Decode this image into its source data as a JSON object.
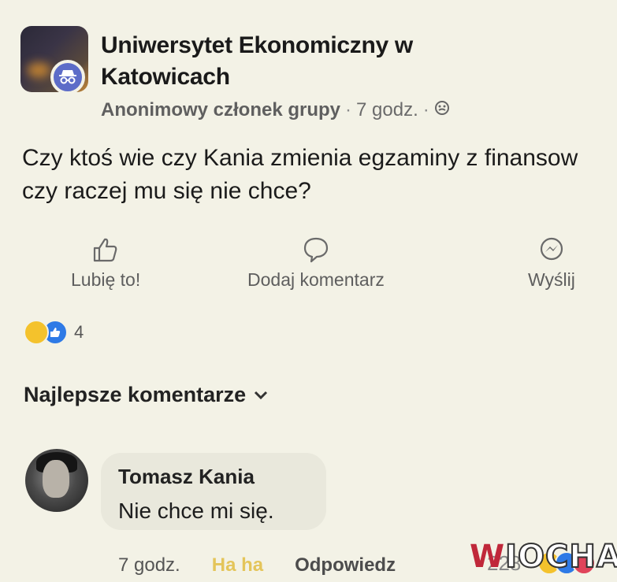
{
  "post": {
    "group_name": "Uniwersytet Ekonomiczny w Katowicach",
    "author": "Anonimowy członek grupy",
    "separator1": "·",
    "time": "7 godz.",
    "separator2": "·",
    "text": "Czy ktoś wie czy Kania zmienia egzaminy z finansow czy raczej mu się nie chce?"
  },
  "actions": {
    "like": "Lubię to!",
    "comment": "Dodaj komentarz",
    "send": "Wyślij"
  },
  "reactions": {
    "count": "4"
  },
  "comments_section": {
    "sort_label": "Najlepsze komentarze"
  },
  "comment": {
    "author": "Tomasz Kania",
    "text": "Nie chce mi się.",
    "time": "7 godz.",
    "haha": "Ha ha",
    "reply": "Odpowiedz",
    "reaction_count": "228"
  },
  "watermark": {
    "first": "W",
    "rest": "IOCHA"
  },
  "colors": {
    "background": "#f3f2e6",
    "anon_badge": "#5c6cc8",
    "haha_reaction": "#f4c22c",
    "like_reaction": "#2e7ae6",
    "haha_text": "#e4c55a"
  }
}
